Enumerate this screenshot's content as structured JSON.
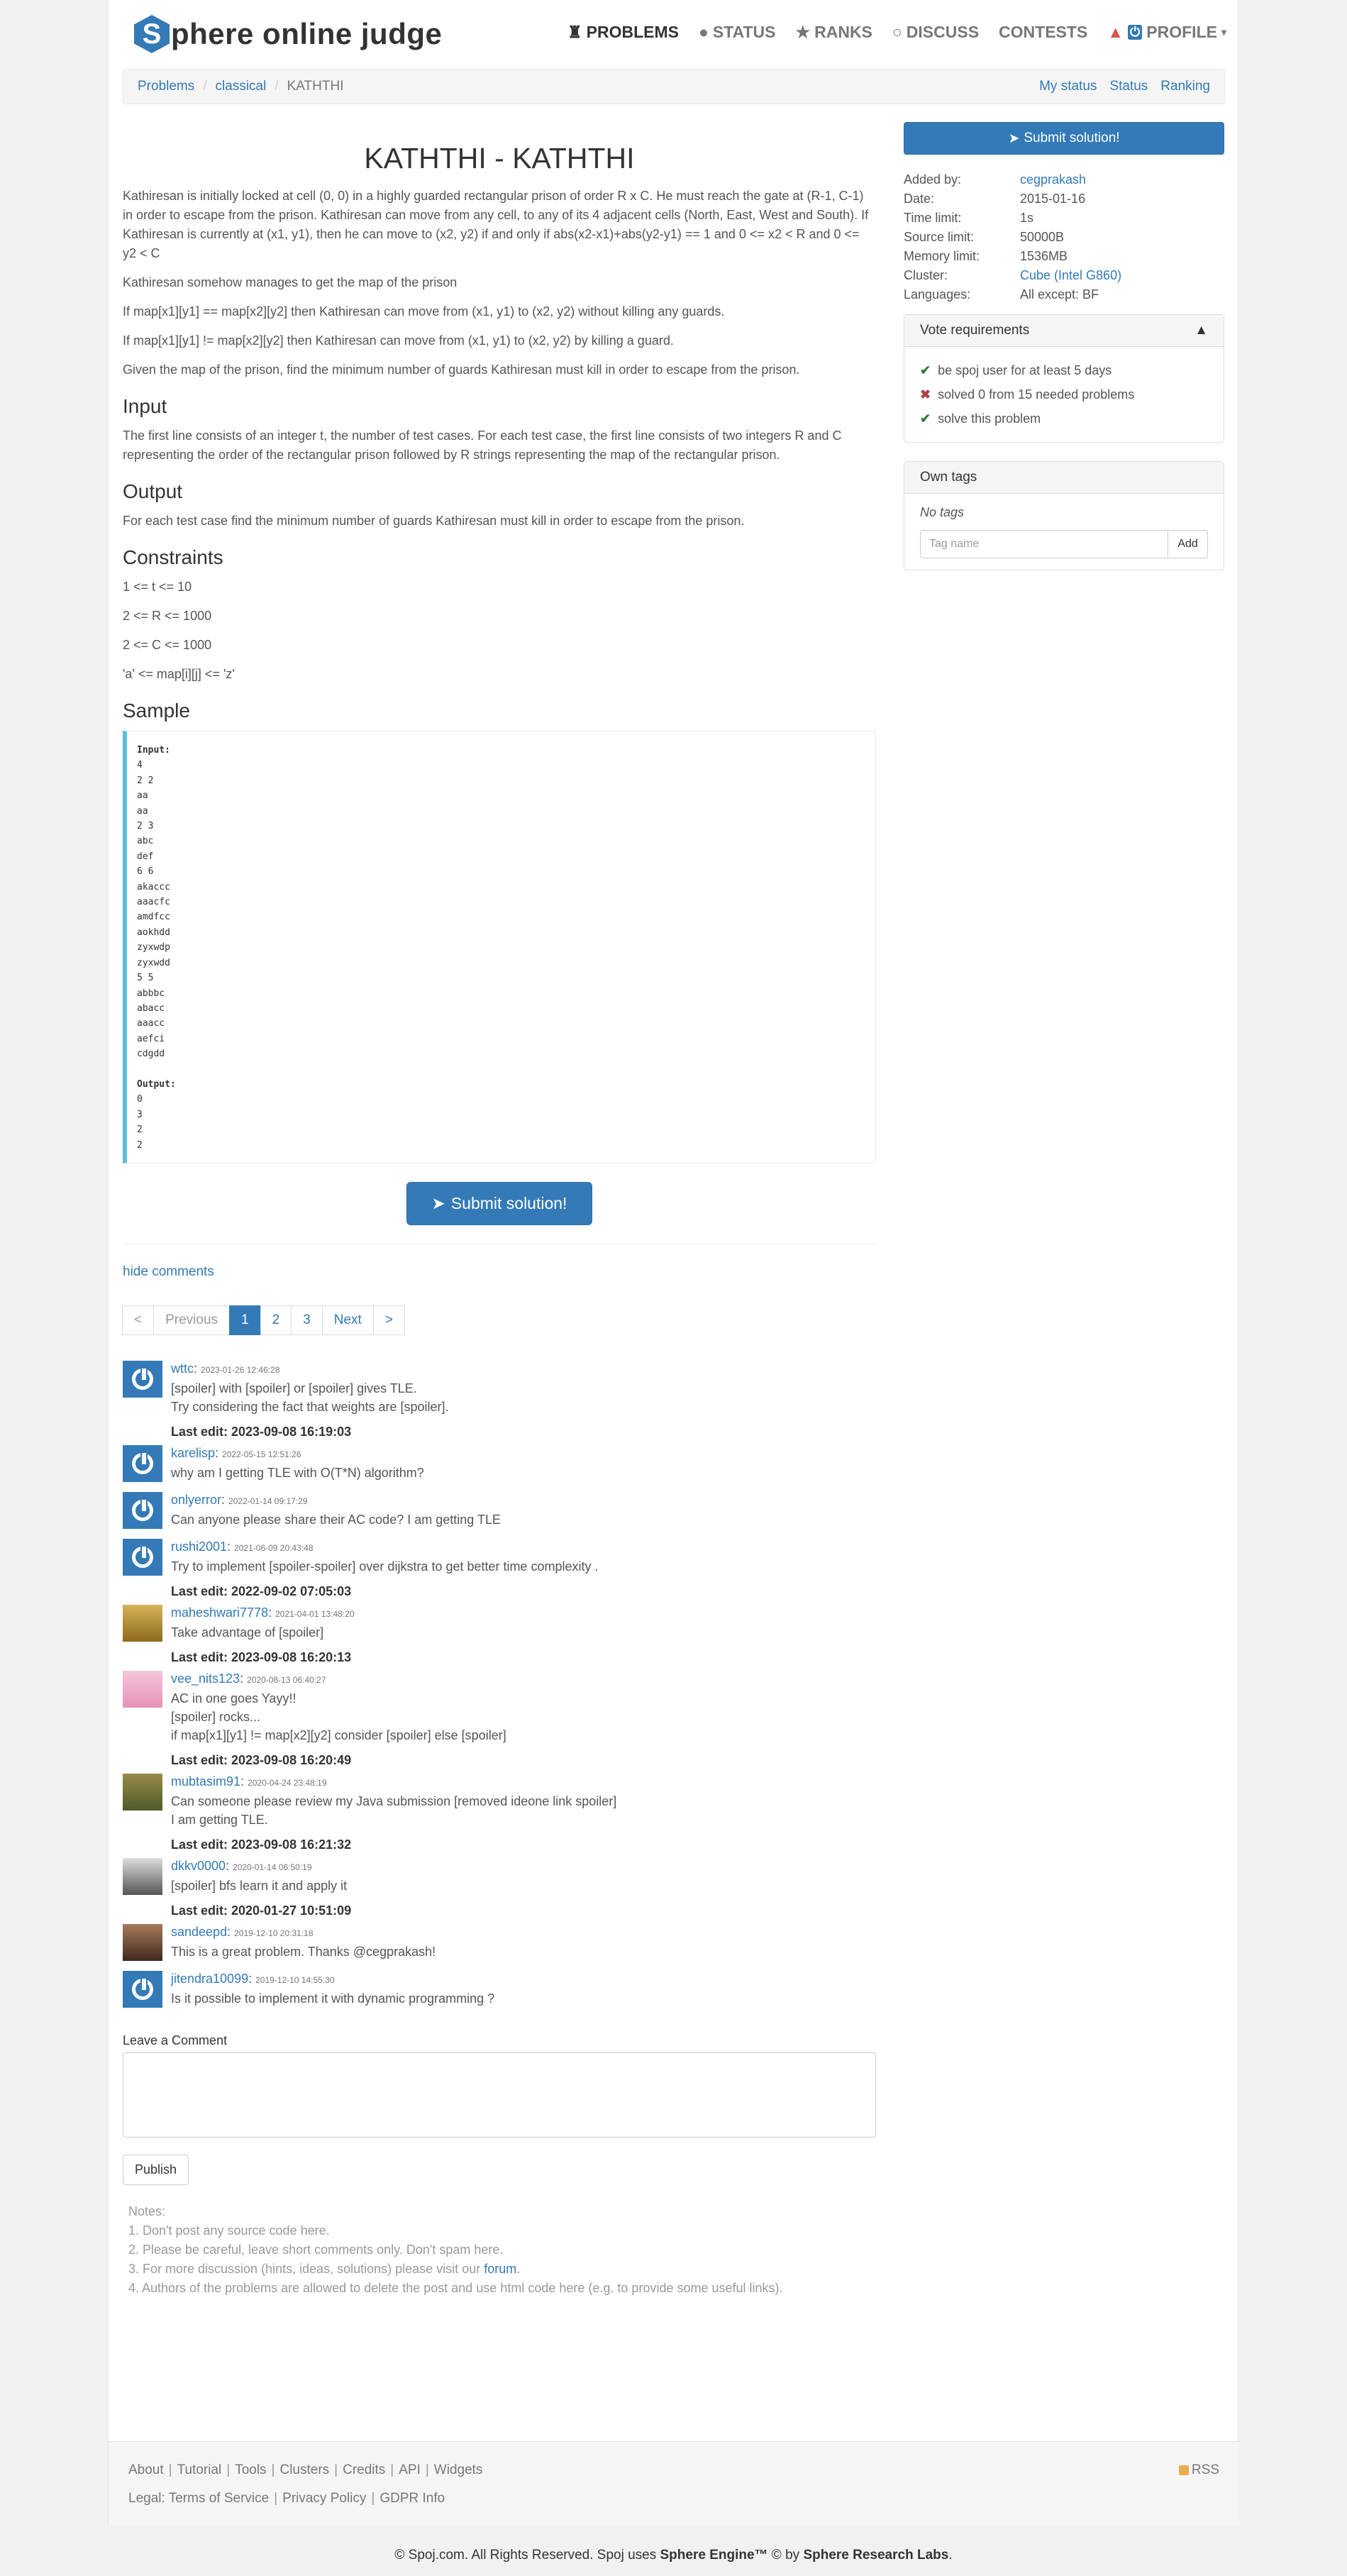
{
  "nav": {
    "logo_letter": "S",
    "logo_text": "phere online judge",
    "items": [
      {
        "label": "PROBLEMS",
        "icon": "puzzle-icon"
      },
      {
        "label": "STATUS",
        "icon": "circle-icon"
      },
      {
        "label": "RANKS",
        "icon": "trophy-icon"
      },
      {
        "label": "DISCUSS",
        "icon": "chat-icon"
      },
      {
        "label": "CONTESTS",
        "icon": ""
      },
      {
        "label": "PROFILE",
        "icon": "power-icon"
      }
    ]
  },
  "breadcrumb": {
    "items": [
      "Problems",
      "classical",
      "KATHTHI"
    ],
    "right": [
      "My status",
      "Status",
      "Ranking"
    ]
  },
  "problem": {
    "title": "KATHTHI - KATHTHI",
    "paragraphs": [
      "Kathiresan is initially locked at cell (0, 0) in a highly guarded rectangular prison of order R x C. He must reach the gate at (R-1, C-1) in order to escape from the prison. Kathiresan can move from any cell, to any of its 4 adjacent cells (North, East, West and South). If Kathiresan is currently at (x1, y1), then he can move to (x2, y2) if and only if abs(x2-x1)+abs(y2-y1) == 1 and 0 <= x2 < R and 0 <= y2 < C",
      "Kathiresan somehow manages to get the map of the prison",
      "If map[x1][y1] == map[x2][y2] then Kathiresan can move from (x1, y1) to (x2, y2) without killing any guards.",
      "If map[x1][y1] != map[x2][y2] then Kathiresan can move from (x1, y1) to (x2, y2) by killing a guard.",
      "Given the map of the prison, find the minimum number of guards Kathiresan must kill in order to escape from the prison."
    ],
    "input_heading": "Input",
    "input_text": "The first line consists of an integer t, the number of test cases. For each test case, the first line consists of two integers R and C representing the order of the rectangular prison followed by R strings representing the map of the rectangular prison.",
    "output_heading": "Output",
    "output_text": "For each test case find the minimum number of guards Kathiresan must kill in order to escape from the prison.",
    "constraints_heading": "Constraints",
    "constraints": [
      "1 <= t <= 10",
      "2 <= R <= 1000",
      "2 <= C <= 1000",
      "'a' <= map[i][j] <= 'z'"
    ],
    "sample_heading": "Sample",
    "sample_input_label": "Input:",
    "sample_input": "4\n2 2\naa\naa\n2 3\nabc\ndef\n6 6\nakaccc\naaacfc\namdfcc\naokhdd\nzyxwdp\nzyxwdd\n5 5\nabbbc\nabacc\naaacc\naefci\ncdgdd",
    "sample_output_label": "Output:",
    "sample_output": "0\n3\n2\n2",
    "submit_label": "Submit solution!"
  },
  "sidebar": {
    "submit_label": "Submit solution!",
    "info": [
      {
        "k": "Added by:",
        "v": "cegprakash",
        "link": true
      },
      {
        "k": "Date:",
        "v": "2015-01-16",
        "link": false
      },
      {
        "k": "Time limit:",
        "v": "1s",
        "link": false
      },
      {
        "k": "Source limit:",
        "v": "50000B",
        "link": false
      },
      {
        "k": "Memory limit:",
        "v": "1536MB",
        "link": false
      },
      {
        "k": "Cluster:",
        "v": "Cube (Intel G860)",
        "link": true
      },
      {
        "k": "Languages:",
        "v": "All except: BF",
        "link": false
      }
    ],
    "vote_title": "Vote requirements",
    "vote_items": [
      {
        "ok": true,
        "text": "be spoj user for at least 5 days"
      },
      {
        "ok": false,
        "text": "solved 0 from 15 needed problems"
      },
      {
        "ok": true,
        "text": "solve this problem"
      }
    ],
    "tags_title": "Own tags",
    "no_tags": "No tags",
    "tag_placeholder": "Tag name",
    "add_label": "Add"
  },
  "comments": {
    "hide_label": "hide comments",
    "pager": [
      "<",
      "Previous",
      "1",
      "2",
      "3",
      "Next",
      ">"
    ],
    "items": [
      {
        "user": "wttc",
        "ts": "2023-01-26 12:46:28",
        "lines": [
          "[spoiler] with [spoiler] or [spoiler] gives TLE.",
          "Try considering the fact that weights are [spoiler]."
        ],
        "avatar": "default",
        "last_edit": "Last edit: 2023-09-08 16:19:03"
      },
      {
        "user": "karelisp",
        "ts": "2022-05-15 12:51:26",
        "lines": [
          "why am I getting TLE with O(T*N) algorithm?"
        ],
        "avatar": "default",
        "last_edit": ""
      },
      {
        "user": "onlyerror",
        "ts": "2022-01-14 09:17:29",
        "lines": [
          "Can anyone please share their AC code? I am getting TLE"
        ],
        "avatar": "default",
        "last_edit": ""
      },
      {
        "user": "rushi2001",
        "ts": "2021-06-09 20:43:48",
        "lines": [
          "Try to implement [spoiler-spoiler] over dijkstra to get better time complexity ."
        ],
        "avatar": "default",
        "last_edit": "Last edit: 2022-09-02 07:05:03"
      },
      {
        "user": "maheshwari7778",
        "ts": "2021-04-01 13:48:20",
        "lines": [
          "Take advantage of [spoiler]"
        ],
        "avatar": "img1",
        "last_edit": "Last edit: 2023-09-08 16:20:13"
      },
      {
        "user": "vee_nits123",
        "ts": "2020-08-13 06:40:27",
        "lines": [
          "AC in one goes Yayy!!",
          "[spoiler] rocks...",
          "if map[x1][y1] != map[x2][y2] consider [spoiler] else [spoiler]"
        ],
        "avatar": "img2",
        "last_edit": "Last edit: 2023-09-08 16:20:49"
      },
      {
        "user": "mubtasim91",
        "ts": "2020-04-24 23:48:19",
        "lines": [
          "Can someone please review my Java submission [removed ideone link spoiler]",
          "I am getting TLE."
        ],
        "avatar": "img3",
        "last_edit": "Last edit: 2023-09-08 16:21:32"
      },
      {
        "user": "dkkv0000",
        "ts": "2020-01-14 06:50:19",
        "lines": [
          "[spoiler] bfs learn it and apply it"
        ],
        "avatar": "img4",
        "last_edit": "Last edit: 2020-01-27 10:51:09"
      },
      {
        "user": "sandeepd",
        "ts": "2019-12-10 20:31:18",
        "lines": [
          "This is a great problem. Thanks @cegprakash!"
        ],
        "avatar": "img5",
        "last_edit": ""
      },
      {
        "user": "jitendra10099",
        "ts": "2019-12-10 14:55:30",
        "lines": [
          "Is it possible to implement it with dynamic programming ?"
        ],
        "avatar": "default",
        "last_edit": ""
      }
    ],
    "leave_label": "Leave a Comment",
    "publish_label": "Publish",
    "notes_title": "Notes:",
    "notes": [
      "1. Don't post any source code here.",
      "2. Please be careful, leave short comments only. Don't spam here.",
      "3. For more discussion (hints, ideas, solutions) please visit our ",
      "4. Authors of the problems are allowed to delete the post and use html code here (e.g. to provide some useful links)."
    ],
    "forum_link": "forum"
  },
  "footer": {
    "links": [
      "About",
      "Tutorial",
      "Tools",
      "Clusters",
      "Credits",
      "API",
      "Widgets"
    ],
    "legal_label": "Legal:",
    "legal": [
      "Terms of Service",
      "Privacy Policy",
      "GDPR Info"
    ],
    "rss": "RSS",
    "copyright_pre": "© Spoj.com. All Rights Reserved. Spoj uses ",
    "copyright_engine": "Sphere Engine™",
    "copyright_mid": " © by ",
    "copyright_labs": "Sphere Research Labs",
    "copyright_end": "."
  }
}
